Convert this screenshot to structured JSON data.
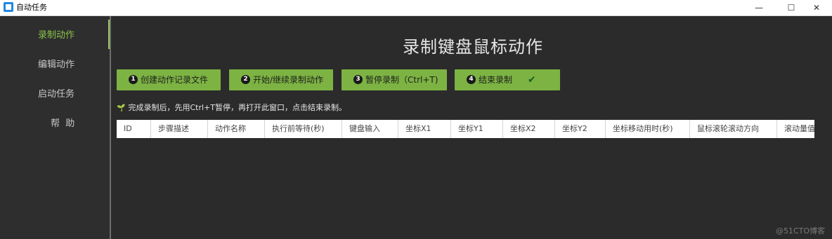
{
  "window": {
    "title": "自动任务",
    "minimize_glyph": "—",
    "maximize_glyph": "☐",
    "close_glyph": "✕"
  },
  "sidebar": {
    "items": [
      {
        "label": "录制动作",
        "active": true
      },
      {
        "label": "编辑动作",
        "active": false
      },
      {
        "label": "启动任务",
        "active": false
      },
      {
        "label": "帮  助",
        "active": false
      }
    ]
  },
  "main": {
    "title": "录制键盘鼠标动作",
    "buttons": [
      {
        "num": "1",
        "label": "创建动作记录文件"
      },
      {
        "num": "2",
        "label": "开始/继续录制动作"
      },
      {
        "num": "3",
        "label": "暂停录制（Ctrl+T)"
      },
      {
        "num": "4",
        "label": "结束录制",
        "check": "✔"
      }
    ],
    "hint": "完成录制后，先用Ctrl+T暂停，再打开此窗口，点击结束录制。",
    "table": {
      "columns": [
        "ID",
        "步骤描述",
        "动作名称",
        "执行前等待(秒)",
        "键盘输入",
        "坐标X1",
        "坐标Y1",
        "坐标X2",
        "坐标Y2",
        "坐标移动用时(秒)",
        "鼠标滚轮滚动方向",
        "滚动量值"
      ]
    }
  },
  "watermark": "@51CTO博客",
  "colors": {
    "accent_green": "#7cb342",
    "active_text": "#8bc34a",
    "background": "#2b2b2b"
  }
}
